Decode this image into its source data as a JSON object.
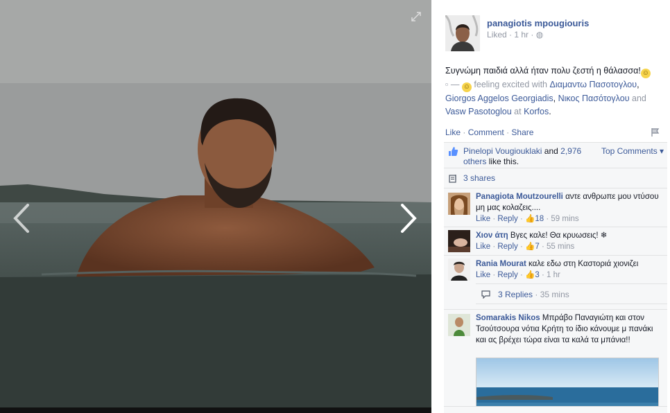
{
  "post": {
    "author": "panagiotis mpougiouris",
    "meta_liked": "Liked",
    "meta_time": "1 hr",
    "text_main": "Συγνώμη παιδιά αλλά ήταν πολυ ζεστή η θάλασσα!",
    "feeling_prefix": "—",
    "feeling_text": "feeling excited with",
    "tag_1": "Διαμαντω Πασοτογλου",
    "tag_2": "Giorgos Aggelos Georgiadis",
    "tag_3": "Νικος Πασότογλου",
    "and_word": "and",
    "tag_4": "Vasw Pasotoglou",
    "at_word": "at",
    "place": "Korfos",
    "punct_comma": ",",
    "punct_period": "."
  },
  "actions": {
    "like": "Like",
    "comment": "Comment",
    "share": "Share",
    "sep": "·"
  },
  "ufi": {
    "liker": "Pinelopi Vougiouklaki",
    "and_word": "and",
    "others_count": "2,976",
    "others_word": "others",
    "likes_suffix": "like this.",
    "top_comments": "Top Comments ▾",
    "shares": "3 shares"
  },
  "comments": [
    {
      "name": "Panagiota Moutzourelli",
      "text": "αντε ανθρωπε μου ντύσου μη μας κολαζεις....",
      "like": "Like",
      "reply": "Reply",
      "likes": "18",
      "time": "59 mins"
    },
    {
      "name": "Χιον άτη",
      "text": "Βγες καλε! Θα κρυωσεις! ❄",
      "like": "Like",
      "reply": "Reply",
      "likes": "7",
      "time": "55 mins"
    },
    {
      "name": "Rania Mourat",
      "text": "καλε εδω στη Καστοριά χιονιζει",
      "like": "Like",
      "reply": "Reply",
      "likes": "3",
      "time": "1 hr"
    },
    {
      "name": "Somarakis Nikos",
      "text": "Μπράβο Παναγιώτη και στον Τσούτσουρα νότια Κρήτη το ίδιο κάνουμε μ πανάκι και ας βρέχει τώρα είναι τα καλά τα μπάνια!!"
    }
  ],
  "replies": {
    "label": "3 Replies",
    "time": "35 mins"
  },
  "icons": {
    "expand": "expand-icon",
    "prev": "chevron-left-icon",
    "next": "chevron-right-icon",
    "globe": "globe-icon",
    "flag": "flag-icon",
    "thumb": "thumbs-up-icon",
    "share": "share-icon",
    "reply": "reply-icon"
  },
  "colors": {
    "link": "#3b5998",
    "muted": "#9197a3",
    "panel": "#f6f7f8"
  }
}
